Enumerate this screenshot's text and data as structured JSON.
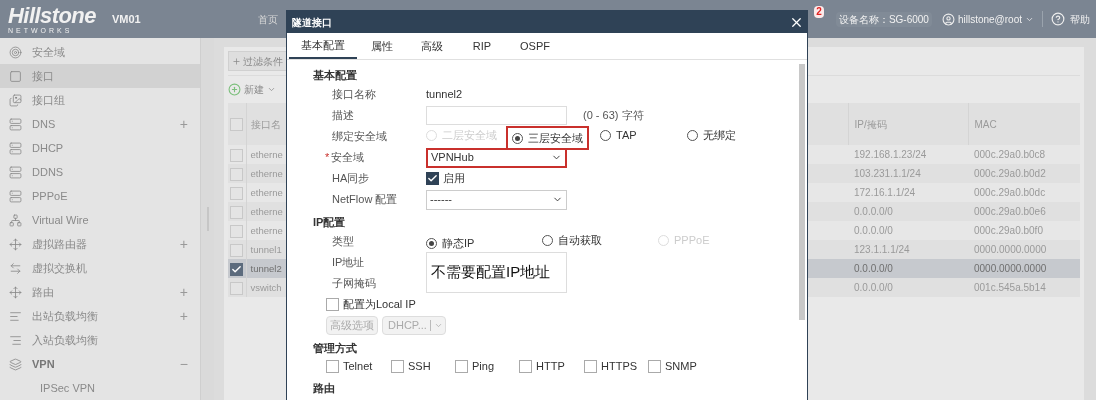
{
  "header": {
    "logo": "Hillstone",
    "logo_sub": "NETWORKS",
    "device": "VM01",
    "nav": [
      "首页"
    ],
    "badge": "2",
    "device_name": "设备名称：SG-6000",
    "user": "hillstone@root",
    "help": "帮助"
  },
  "sidebar": {
    "items": [
      {
        "label": "安全域",
        "selected": false
      },
      {
        "label": "接口",
        "selected": true
      },
      {
        "label": "接口组",
        "selected": false
      },
      {
        "label": "DNS",
        "selected": false,
        "toggle": "+",
        "expanded": false
      },
      {
        "label": "DHCP",
        "selected": false
      },
      {
        "label": "DDNS",
        "selected": false
      },
      {
        "label": "PPPoE",
        "selected": false
      },
      {
        "label": "Virtual Wire",
        "selected": false
      },
      {
        "label": "虚拟路由器",
        "selected": false,
        "toggle": "+",
        "expanded": false
      },
      {
        "label": "虚拟交换机",
        "selected": false
      },
      {
        "label": "路由",
        "selected": false,
        "toggle": "+",
        "expanded": false
      },
      {
        "label": "出站负载均衡",
        "selected": false,
        "toggle": "+",
        "expanded": false
      },
      {
        "label": "入站负载均衡",
        "selected": false
      },
      {
        "label": "VPN",
        "selected": false,
        "toggle": "−",
        "expanded": true,
        "children": [
          {
            "label": "IPSec VPN",
            "selected": false
          }
        ]
      }
    ]
  },
  "main": {
    "filter_button": "过滤条件",
    "new_button": "新建",
    "table": {
      "columns": [
        "接口名",
        "IP/掩码",
        "MAC"
      ],
      "all_checked": false,
      "rows": [
        {
          "selected": false,
          "name": "etherne",
          "ip": "192.168.1.23/24",
          "mac": "000c.29a0.b0c8"
        },
        {
          "selected": false,
          "name": "etherne",
          "ip": "103.231.1.1/24",
          "mac": "000c.29a0.b0d2"
        },
        {
          "selected": false,
          "name": "etherne",
          "ip": "172.16.1.1/24",
          "mac": "000c.29a0.b0dc"
        },
        {
          "selected": false,
          "name": "etherne",
          "ip": "0.0.0.0/0",
          "mac": "000c.29a0.b0e6"
        },
        {
          "selected": false,
          "name": "etherne",
          "ip": "0.0.0.0/0",
          "mac": "000c.29a0.b0f0"
        },
        {
          "selected": false,
          "name": "tunnel1",
          "ip": "123.1.1.1/24",
          "mac": "0000.0000.0000"
        },
        {
          "selected": true,
          "name": "tunnel2",
          "ip": "0.0.0.0/0",
          "mac": "0000.0000.0000"
        },
        {
          "selected": false,
          "name": "vswitch",
          "ip": "0.0.0.0/0",
          "mac": "001c.545a.5b14"
        }
      ]
    }
  },
  "dialog": {
    "title": "隧道接口",
    "tabs": [
      {
        "label": "基本配置",
        "selected": true
      },
      {
        "label": "属性",
        "selected": false
      },
      {
        "label": "高级",
        "selected": false
      },
      {
        "label": "RIP",
        "selected": false
      },
      {
        "label": "OSPF",
        "selected": false
      }
    ],
    "sections": [
      {
        "label": "基本配置",
        "rows": [
          {
            "kind": "text",
            "label": "接口名称",
            "value": "tunnel2"
          },
          {
            "kind": "input",
            "label": "描述",
            "hint": "(0 - 63) 字符"
          },
          {
            "kind": "radio",
            "label": "绑定安全域",
            "options": [
              {
                "label": "二层安全域",
                "selected": false,
                "disabled": true,
                "highlighted": false
              },
              {
                "label": "三层安全域",
                "selected": true,
                "disabled": false,
                "highlighted": true
              },
              {
                "label": "TAP",
                "selected": false,
                "disabled": false,
                "highlighted": false
              },
              {
                "label": "无绑定",
                "selected": false,
                "disabled": false,
                "highlighted": false
              }
            ]
          },
          {
            "kind": "select",
            "label": "安全域",
            "mark": "*",
            "value": "VPNHub",
            "highlighted": true
          },
          {
            "kind": "checkbox",
            "label": "HA同步",
            "option": "启用",
            "checked": true
          },
          {
            "kind": "select",
            "label": "NetFlow 配置",
            "value": "------",
            "highlighted": false
          }
        ]
      },
      {
        "label": "IP配置",
        "rows": [
          {
            "kind": "radio",
            "label": "类型",
            "options": [
              {
                "label": "静态IP",
                "selected": true,
                "disabled": false,
                "highlighted": false
              },
              {
                "label": "自动获取",
                "selected": false,
                "disabled": false,
                "highlighted": false
              },
              {
                "label": "PPPoE",
                "selected": false,
                "disabled": true,
                "highlighted": false
              }
            ]
          },
          {
            "kind": "ip_fields",
            "labels": [
              "IP地址",
              "子网掩码"
            ],
            "annotation": "不需要配置IP地址"
          },
          {
            "kind": "lone_checkbox",
            "label": "配置为Local IP",
            "checked": false
          },
          {
            "kind": "buttons",
            "buttons": [
              {
                "label": "高级选项",
                "disabled": true
              },
              {
                "label": "DHCP...",
                "disabled": true
              }
            ]
          }
        ]
      },
      {
        "label": "管理方式",
        "rows": [
          {
            "kind": "checks",
            "options": [
              {
                "label": "Telnet",
                "checked": false
              },
              {
                "label": "SSH",
                "checked": false
              },
              {
                "label": "Ping",
                "checked": false
              },
              {
                "label": "HTTP",
                "checked": false
              },
              {
                "label": "HTTPS",
                "checked": false
              },
              {
                "label": "SNMP",
                "checked": false
              }
            ]
          }
        ]
      },
      {
        "label": "路由"
      }
    ]
  }
}
